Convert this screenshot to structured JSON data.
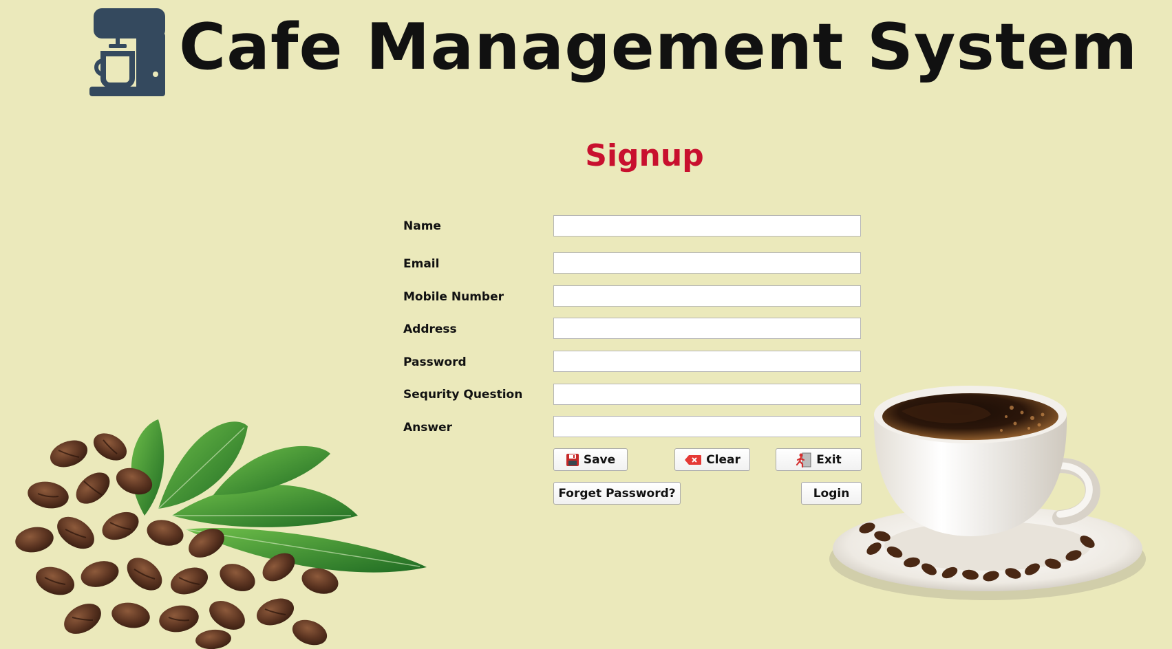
{
  "header": {
    "title": "Cafe Management System",
    "icon": "coffee-machine-icon"
  },
  "form": {
    "title": "Signup",
    "fields": [
      {
        "label": "Name",
        "value": ""
      },
      {
        "label": "Email",
        "value": ""
      },
      {
        "label": "Mobile Number",
        "value": ""
      },
      {
        "label": "Address",
        "value": ""
      },
      {
        "label": "Password",
        "value": ""
      },
      {
        "label": "Sequrity Question",
        "value": ""
      },
      {
        "label": "Answer",
        "value": ""
      }
    ],
    "buttons": {
      "save": {
        "label": "Save",
        "icon": "floppy-disk-icon"
      },
      "clear": {
        "label": "Clear",
        "icon": "erase-icon"
      },
      "exit": {
        "label": "Exit",
        "icon": "exit-door-icon"
      },
      "forget_password": {
        "label": "Forget Password?"
      },
      "login": {
        "label": "Login"
      }
    }
  },
  "decorations": {
    "left": "coffee-beans-with-leaves",
    "right": "coffee-cup-on-saucer"
  },
  "colors": {
    "background": "#ebe9bb",
    "title_accent": "#c8102e",
    "logo": "#34495e"
  }
}
